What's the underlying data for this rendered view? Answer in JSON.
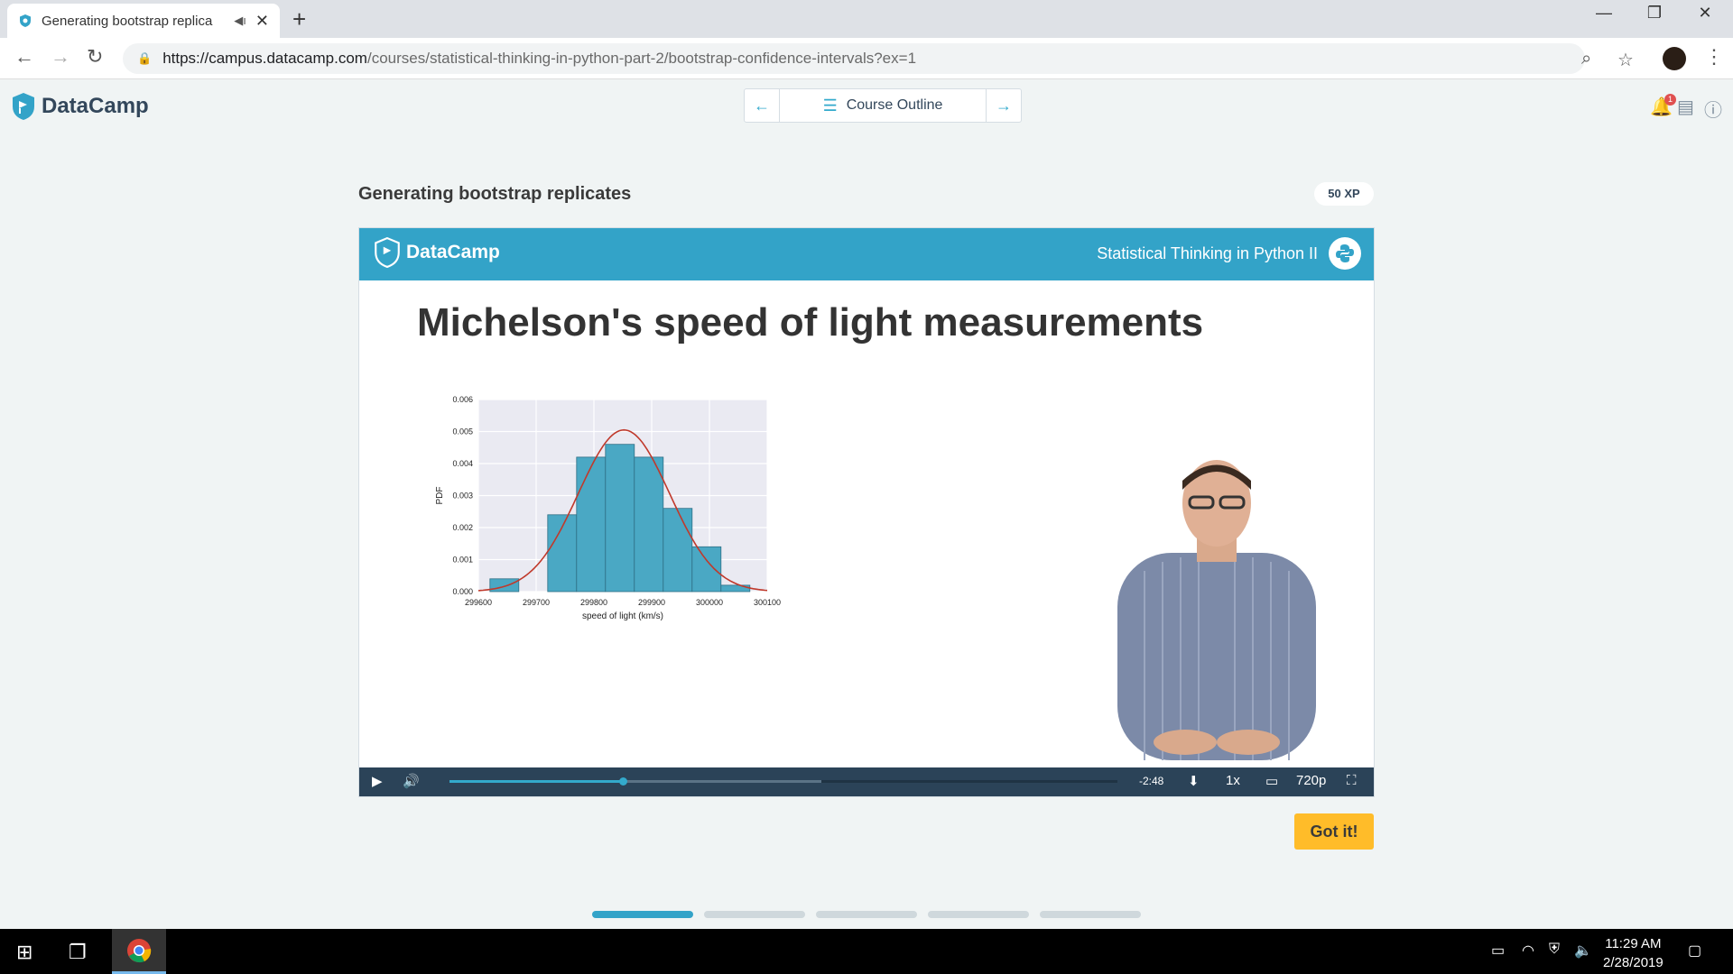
{
  "browser": {
    "tab_title": "Generating bootstrap replica",
    "url_host": "https://campus.datacamp.com",
    "url_path": "/courses/statistical-thinking-in-python-part-2/bootstrap-confidence-intervals?ex=1"
  },
  "header": {
    "brand": "DataCamp",
    "outline_label": "Course Outline",
    "notification_count": "1"
  },
  "exercise": {
    "title": "Generating bootstrap replicates",
    "xp": "50 XP"
  },
  "slide": {
    "brand": "DataCamp",
    "course": "Statistical Thinking in Python II",
    "heading": "Michelson's speed of light measurements"
  },
  "chart_data": {
    "type": "bar",
    "title": "",
    "xlabel": "speed of light (km/s)",
    "ylabel": "PDF",
    "xlim": [
      299600,
      300100
    ],
    "ylim": [
      0,
      0.006
    ],
    "x_ticks": [
      "299600",
      "299700",
      "299800",
      "299900",
      "300000",
      "300100"
    ],
    "y_ticks": [
      "0.000",
      "0.001",
      "0.002",
      "0.003",
      "0.004",
      "0.005",
      "0.006"
    ],
    "bins": [
      {
        "x0": 299620,
        "x1": 299670,
        "value": 0.0004
      },
      {
        "x0": 299670,
        "x1": 299720,
        "value": 0.0
      },
      {
        "x0": 299720,
        "x1": 299770,
        "value": 0.0024
      },
      {
        "x0": 299770,
        "x1": 299820,
        "value": 0.0042
      },
      {
        "x0": 299820,
        "x1": 299870,
        "value": 0.0046
      },
      {
        "x0": 299870,
        "x1": 299920,
        "value": 0.0042
      },
      {
        "x0": 299920,
        "x1": 299970,
        "value": 0.0026
      },
      {
        "x0": 299970,
        "x1": 300020,
        "value": 0.0014
      },
      {
        "x0": 300020,
        "x1": 300070,
        "value": 0.0002
      }
    ],
    "normal_curve": {
      "mean": 299852,
      "std": 79
    },
    "bar_color": "#4aa8c4",
    "curve_color": "#c0392b",
    "grid": true
  },
  "player": {
    "time_remaining": "-2:48",
    "speed": "1x",
    "quality": "720p",
    "progress": 0.26
  },
  "actions": {
    "got_it": "Got it!"
  },
  "lesson_progress": {
    "segments": 5,
    "active": 0
  },
  "taskbar": {
    "time": "11:29 AM",
    "date": "2/28/2019"
  },
  "colors": {
    "brand_blue": "#33a3c8",
    "cta_yellow": "#ffbc29",
    "player_bar": "#2b4358"
  }
}
